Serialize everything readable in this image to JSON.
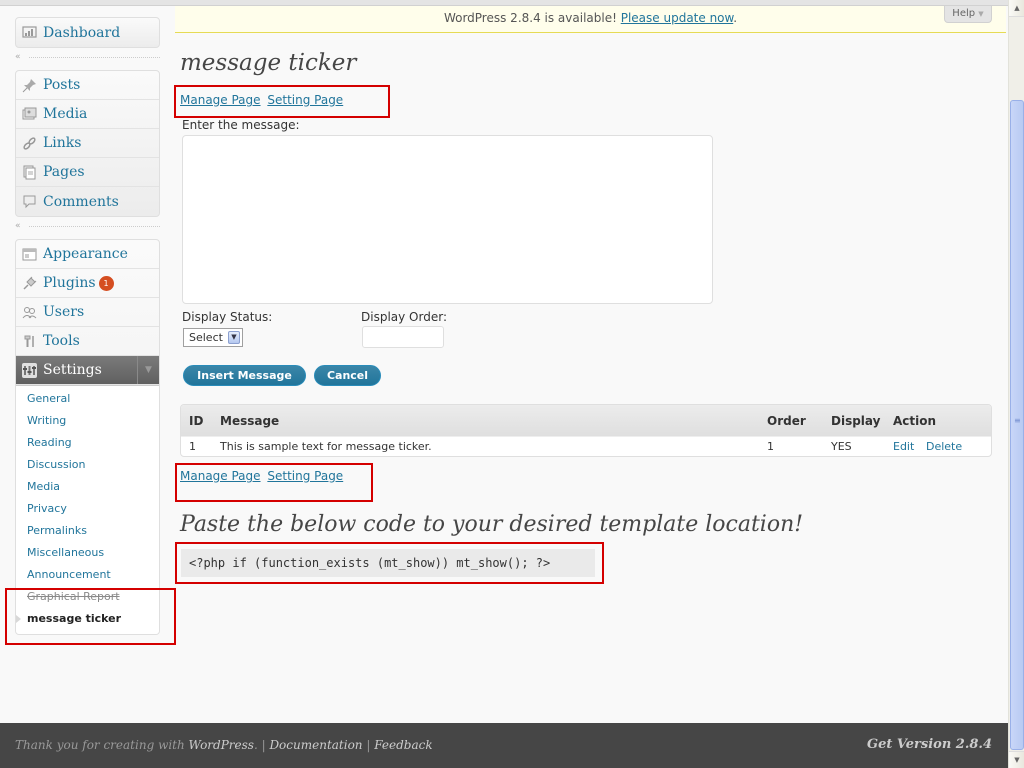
{
  "sidebar": {
    "group1": [
      {
        "label": "Dashboard",
        "icon": "dashboard-icon"
      }
    ],
    "group2": [
      {
        "label": "Posts",
        "icon": "pin-icon"
      },
      {
        "label": "Media",
        "icon": "media-icon"
      },
      {
        "label": "Links",
        "icon": "link-icon"
      },
      {
        "label": "Pages",
        "icon": "pages-icon"
      },
      {
        "label": "Comments",
        "icon": "comment-icon"
      }
    ],
    "group3": [
      {
        "label": "Appearance",
        "icon": "appearance-icon"
      },
      {
        "label": "Plugins",
        "icon": "plug-icon",
        "badge": "1"
      },
      {
        "label": "Users",
        "icon": "users-icon"
      },
      {
        "label": "Tools",
        "icon": "tools-icon"
      },
      {
        "label": "Settings",
        "icon": "settings-icon"
      }
    ],
    "submenu": [
      "General",
      "Writing",
      "Reading",
      "Discussion",
      "Media",
      "Privacy",
      "Permalinks",
      "Miscellaneous",
      "Announcement",
      "Graphical Report",
      "message ticker"
    ]
  },
  "update_nag": {
    "text": "WordPress 2.8.4 is available! ",
    "link": "Please update now",
    "end": "."
  },
  "help": {
    "label": "Help"
  },
  "page": {
    "title": "message ticker",
    "manage_link": "Manage Page",
    "setting_link": "Setting Page",
    "message_label": "Enter the message:",
    "status_label": "Display Status:",
    "order_label": "Display Order:",
    "status_value": "Select",
    "insert_button": "Insert Message",
    "cancel_button": "Cancel"
  },
  "table": {
    "headers": [
      "ID",
      "Message",
      "Order",
      "Display",
      "Action"
    ],
    "rows": [
      {
        "id": "1",
        "message": "This is sample text for message ticker.",
        "order": "1",
        "display": "YES",
        "edit": "Edit",
        "delete": "Delete"
      }
    ]
  },
  "code_section": {
    "title": "Paste the below code to your desired template location!",
    "code": "<?php if (function_exists (mt_show)) mt_show(); ?>"
  },
  "footer": {
    "thanks": "Thank you for creating with ",
    "wp": "WordPress",
    "sep1": ". | ",
    "doc": "Documentation",
    "sep2": " | ",
    "feedback": "Feedback",
    "version": "Get Version 2.8.4"
  },
  "colors": {
    "link": "#21759b",
    "highlight_box": "#d40000",
    "footer_bg": "#464646",
    "badge": "#d54e21"
  }
}
